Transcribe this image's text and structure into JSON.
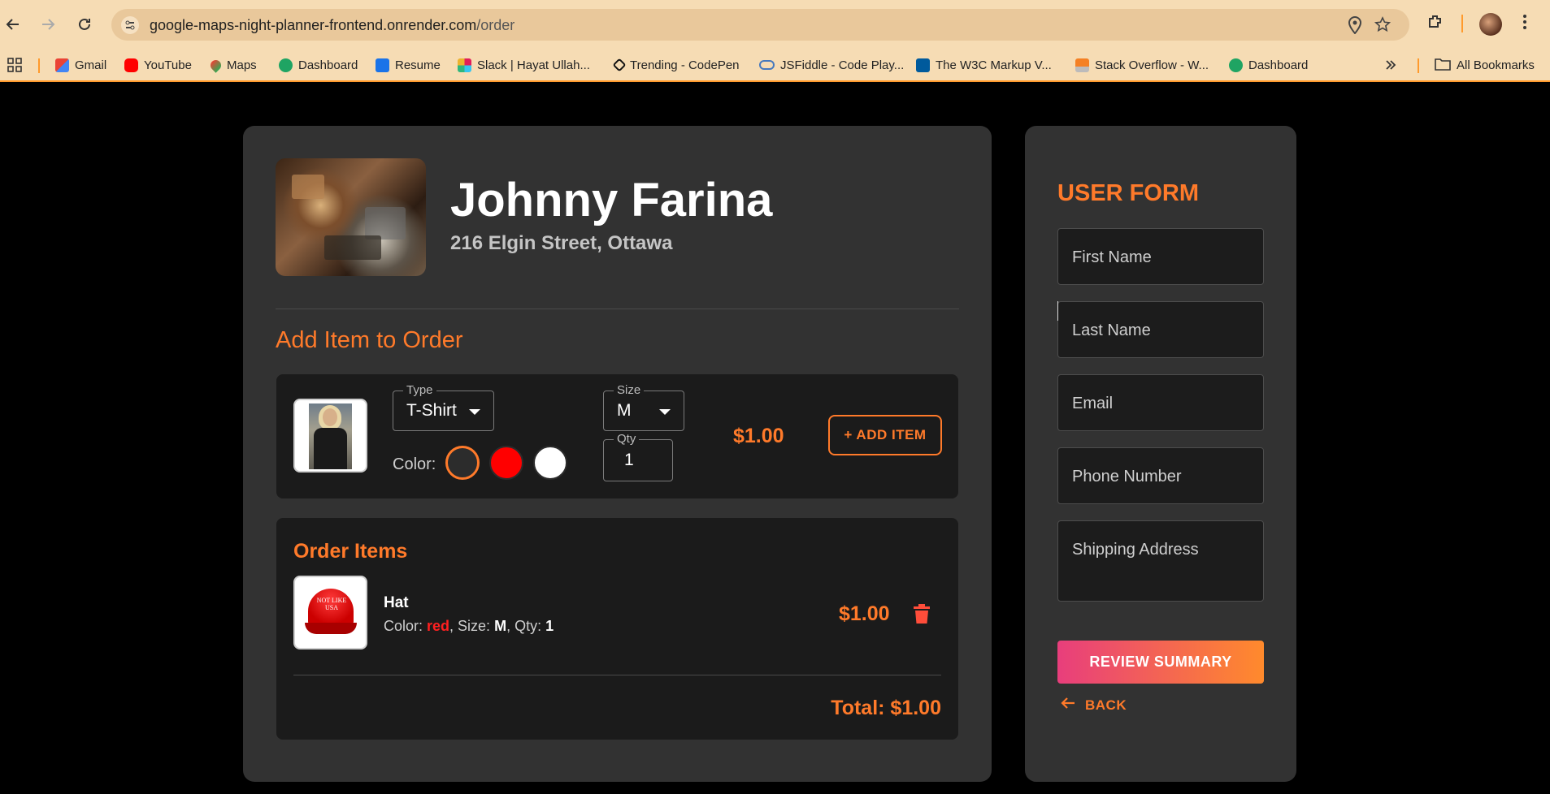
{
  "browser": {
    "url_host": "google-maps-night-planner-frontend.onrender.com",
    "url_path": "/order",
    "bookmarks": [
      {
        "label": "Gmail",
        "color": "#ea4335"
      },
      {
        "label": "YouTube",
        "color": "#ff0000"
      },
      {
        "label": "Maps",
        "color": "#34a853"
      },
      {
        "label": "Dashboard",
        "color": "#1fa463"
      },
      {
        "label": "Resume",
        "color": "#1a73e8"
      },
      {
        "label": "Slack | Hayat Ullah...",
        "color": "#e01e5a"
      },
      {
        "label": "Trending - CodePen",
        "color": "#111111"
      },
      {
        "label": "JSFiddle - Code Play...",
        "color": "#4679bd"
      },
      {
        "label": "The W3C Markup V...",
        "color": "#005a9c"
      },
      {
        "label": "Stack Overflow - W...",
        "color": "#f48024"
      },
      {
        "label": "Dashboard",
        "color": "#1fa463"
      }
    ],
    "all_bookmarks_label": "All Bookmarks"
  },
  "store": {
    "name": "Johnny Farina",
    "address": "216 Elgin Street, Ottawa"
  },
  "add_item": {
    "section_title": "Add Item to Order",
    "type_legend": "Type",
    "type_value": "T-Shirt",
    "size_legend": "Size",
    "size_value": "M",
    "qty_legend": "Qty",
    "qty_value": "1",
    "color_label": "Color:",
    "colors": [
      {
        "name": "dark",
        "hex": "#2c2c2c",
        "selected": true
      },
      {
        "name": "red",
        "hex": "#ff0000",
        "selected": false
      },
      {
        "name": "white",
        "hex": "#ffffff",
        "selected": false
      }
    ],
    "price": "$1.00",
    "add_button": "+ ADD ITEM"
  },
  "order": {
    "title": "Order Items",
    "items": [
      {
        "name": "Hat",
        "color_prefix": "Color: ",
        "color_value": "red",
        "size_prefix": ", Size: ",
        "size_value": "M",
        "qty_prefix": ", Qty: ",
        "qty_value": "1",
        "price": "$1.00",
        "hat_text": "NOT LIKE USA"
      }
    ],
    "total": "Total: $1.00"
  },
  "user_form": {
    "title": "USER FORM",
    "first_name_placeholder": "First Name",
    "last_name_placeholder": "Last Name",
    "email_placeholder": "Email",
    "phone_placeholder": "Phone Number",
    "address_placeholder": "Shipping Address",
    "review_button": "REVIEW SUMMARY",
    "back_label": "BACK"
  },
  "colors": {
    "accent": "#ff7a2a",
    "panel": "#323232",
    "inner_panel": "#1b1b1b",
    "page_bg": "#000000"
  }
}
